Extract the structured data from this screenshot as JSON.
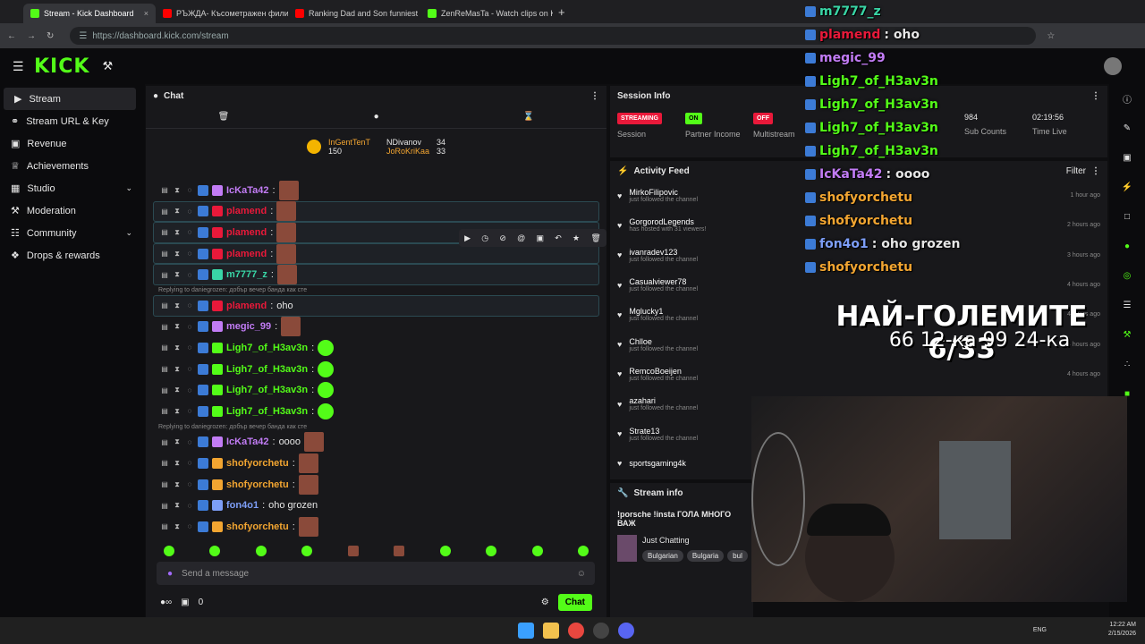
{
  "browser": {
    "tabs": [
      "Stream - Kick Dashboard",
      "РЪЖДА- Късометражен фили",
      "Ranking Dad and Son funniest",
      "ZenReMasTa - Watch clips on K"
    ],
    "url": "https://dashboard.kick.com/stream"
  },
  "logo": "KICK",
  "sidebar": {
    "items": [
      "Stream",
      "Stream URL & Key",
      "Revenue",
      "Achievements",
      "Studio",
      "Moderation",
      "Community",
      "Drops & rewards"
    ]
  },
  "chat": {
    "title": "Chat",
    "top": {
      "first": "InGentTenT",
      "first_count": "150",
      "second": "NDivanov",
      "second_count": "34",
      "third": "JoRoKriKaa",
      "third_count": "33"
    },
    "messages": [
      {
        "user": "IcKaTa42",
        "color": "#c27cf5",
        "text": "",
        "emote": true
      },
      {
        "user": "plamend",
        "color": "#e9193a",
        "text": "",
        "emote": true,
        "hl": true
      },
      {
        "user": "plamend",
        "color": "#e9193a",
        "text": "",
        "emote": true,
        "hl": true
      },
      {
        "user": "plamend",
        "color": "#e9193a",
        "text": "",
        "emote": true,
        "hl": true
      },
      {
        "user": "m7777_z",
        "color": "#39d6a6",
        "text": "",
        "emote": true,
        "hl": true
      },
      {
        "user": "plamend",
        "color": "#e9193a",
        "text": "oho",
        "hl": true,
        "reply": "Replying to daniegrozen: добър вечер банда как сте"
      },
      {
        "user": "megic_99",
        "color": "#c27cf5",
        "text": "",
        "emote": true
      },
      {
        "user": "Ligh7_of_H3av3n",
        "color": "#53fc18",
        "text": "",
        "green": true
      },
      {
        "user": "Ligh7_of_H3av3n",
        "color": "#53fc18",
        "text": "",
        "green": true
      },
      {
        "user": "Ligh7_of_H3av3n",
        "color": "#53fc18",
        "text": "",
        "green": true
      },
      {
        "user": "Ligh7_of_H3av3n",
        "color": "#53fc18",
        "text": "",
        "green": true
      },
      {
        "user": "IcKaTa42",
        "color": "#c27cf5",
        "text": "oooo",
        "emote": true,
        "reply": "Replying to daniegrozen: добър вечер банда как сте"
      },
      {
        "user": "shofyorchetu",
        "color": "#f2a531",
        "text": "",
        "emote": true
      },
      {
        "user": "shofyorchetu",
        "color": "#f2a531",
        "text": "",
        "emote": true
      },
      {
        "user": "fon4o1",
        "color": "#7d9ef7",
        "text": "oho grozen"
      },
      {
        "user": "shofyorchetu",
        "color": "#f2a531",
        "text": "",
        "emote": true
      }
    ],
    "input_placeholder": "Send a message",
    "footer_count": "0",
    "send": "Chat"
  },
  "session": {
    "title": "Session Info",
    "streaming": "STREAMING",
    "session": "Session",
    "on": "ON",
    "partner": "Partner Income",
    "off": "OFF",
    "multistream": "Multistream",
    "subs_value": "984",
    "subs_label": "Sub Counts",
    "time_value": "02:19:56",
    "time_label": "Time Live"
  },
  "activity": {
    "title": "Activity Feed",
    "filter": "Filter",
    "items": [
      {
        "name": "MirkoFilipovic",
        "sub": "just followed the channel",
        "time": "1 hour ago"
      },
      {
        "name": "GorgorodLegends",
        "sub": "has hosted with 31 viewers!",
        "time": "2 hours ago"
      },
      {
        "name": "ivanradev123",
        "sub": "just followed the channel",
        "time": "3 hours ago"
      },
      {
        "name": "Casualviewer78",
        "sub": "just followed the channel",
        "time": "4 hours ago"
      },
      {
        "name": "Mglucky1",
        "sub": "just followed the channel",
        "time": "4 hours ago"
      },
      {
        "name": "Chlloe",
        "sub": "just followed the channel",
        "time": "4 hours ago"
      },
      {
        "name": "RemcoBoeijen",
        "sub": "just followed the channel",
        "time": "4 hours ago"
      },
      {
        "name": "azahari",
        "sub": "just followed the channel",
        "time": ""
      },
      {
        "name": "Strate13",
        "sub": "just followed the channel",
        "time": ""
      },
      {
        "name": "sportsgaming4k",
        "sub": "",
        "time": ""
      }
    ]
  },
  "stream_info": {
    "title": "Stream info",
    "stream_title": "!porsche !insta ГОЛА МНОГО ВАЖ",
    "category": "Just Chatting",
    "tags": [
      "Bulgarian",
      "Bulgaria",
      "bul"
    ]
  },
  "overlay": {
    "lines": [
      {
        "user": "m7777_z",
        "color": "#39d6a6",
        "text": ""
      },
      {
        "user": "plamend",
        "color": "#e9193a",
        "text": ": oho"
      },
      {
        "user": "megic_99",
        "color": "#c27cf5",
        "text": ""
      },
      {
        "user": "Ligh7_of_H3av3n",
        "color": "#53fc18",
        "text": ""
      },
      {
        "user": "Ligh7_of_H3av3n",
        "color": "#53fc18",
        "text": ""
      },
      {
        "user": "Ligh7_of_H3av3n",
        "color": "#53fc18",
        "text": ""
      },
      {
        "user": "Ligh7_of_H3av3n",
        "color": "#53fc18",
        "text": ""
      },
      {
        "user": "IcKaTa42",
        "color": "#c27cf5",
        "text": ": oooo"
      },
      {
        "user": "shofyorchetu",
        "color": "#f2a531",
        "text": ""
      },
      {
        "user": "shofyorchetu",
        "color": "#f2a531",
        "text": ""
      },
      {
        "user": "fon4o1",
        "color": "#7d9ef7",
        "text": ": oho grozen"
      },
      {
        "user": "shofyorchetu",
        "color": "#f2a531",
        "text": ""
      }
    ],
    "headline": "НАЙ-ГОЛЕМИТЕ 6/33",
    "subline": "66 12-ка 99 24-ка"
  },
  "taskbar": {
    "lang": "ENG",
    "time": "12:22 AM",
    "date": "2/15/2026"
  }
}
